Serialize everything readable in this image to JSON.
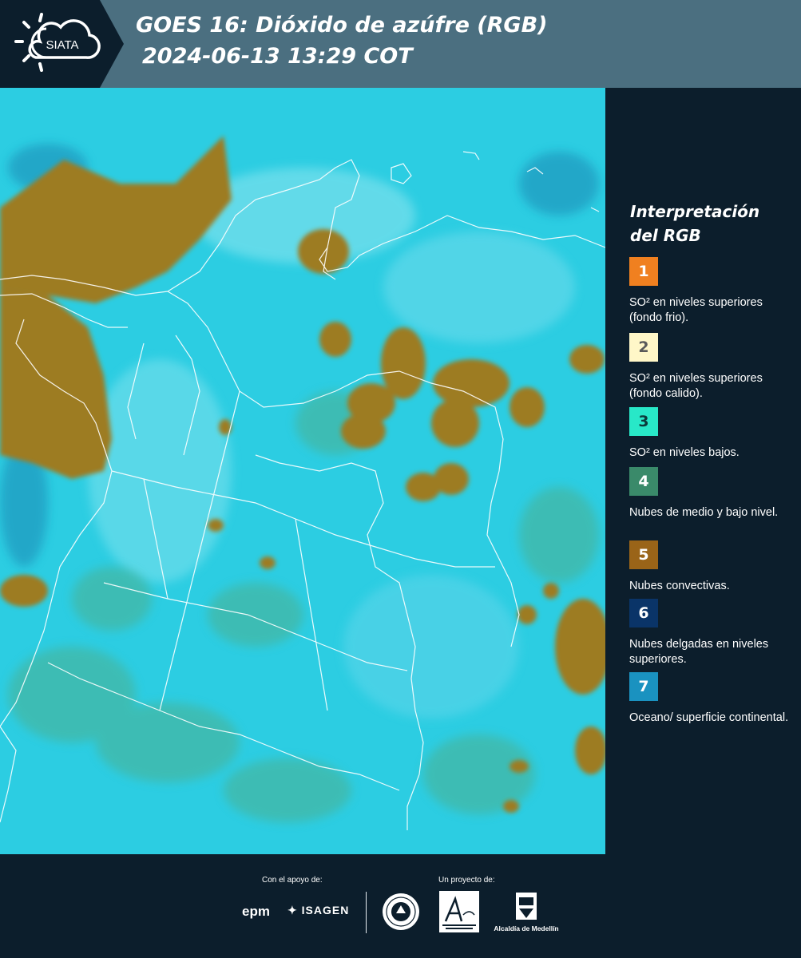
{
  "header": {
    "logo_text": "SIATA",
    "title_line1": "GOES 16: Dióxido de azúfre (RGB)",
    "title_line2": "2024-06-13 13:29 COT"
  },
  "map": {
    "icon": "satellite-map-image",
    "background_color": "#27c9e0"
  },
  "legend": {
    "title": "Interpretación del RGB",
    "items": [
      {
        "number": "1",
        "color": "#f08020",
        "label": "SO² en niveles superiores (fondo frio)."
      },
      {
        "number": "2",
        "color": "#fff7c8",
        "label": "SO² en niveles superiores (fondo calido)."
      },
      {
        "number": "3",
        "color": "#28e8c8",
        "label": "SO² en niveles bajos."
      },
      {
        "number": "4",
        "color": "#3a8a6a",
        "label": "Nubes de medio y bajo nivel."
      },
      {
        "number": "5",
        "color": "#9a6418",
        "label": "Nubes convectivas."
      },
      {
        "number": "6",
        "color": "#0a3468",
        "label": "Nubes delgadas en niveles superiores."
      },
      {
        "number": "7",
        "color": "#1a92c0",
        "label": "Oceano/ superficie continental."
      }
    ]
  },
  "footer": {
    "support_label": "Con el apoyo de:",
    "project_label": "Un proyecto de:",
    "epm": "epm",
    "isagen": "ISAGEN",
    "alcaldia": "Alcaldía de Medellín"
  }
}
